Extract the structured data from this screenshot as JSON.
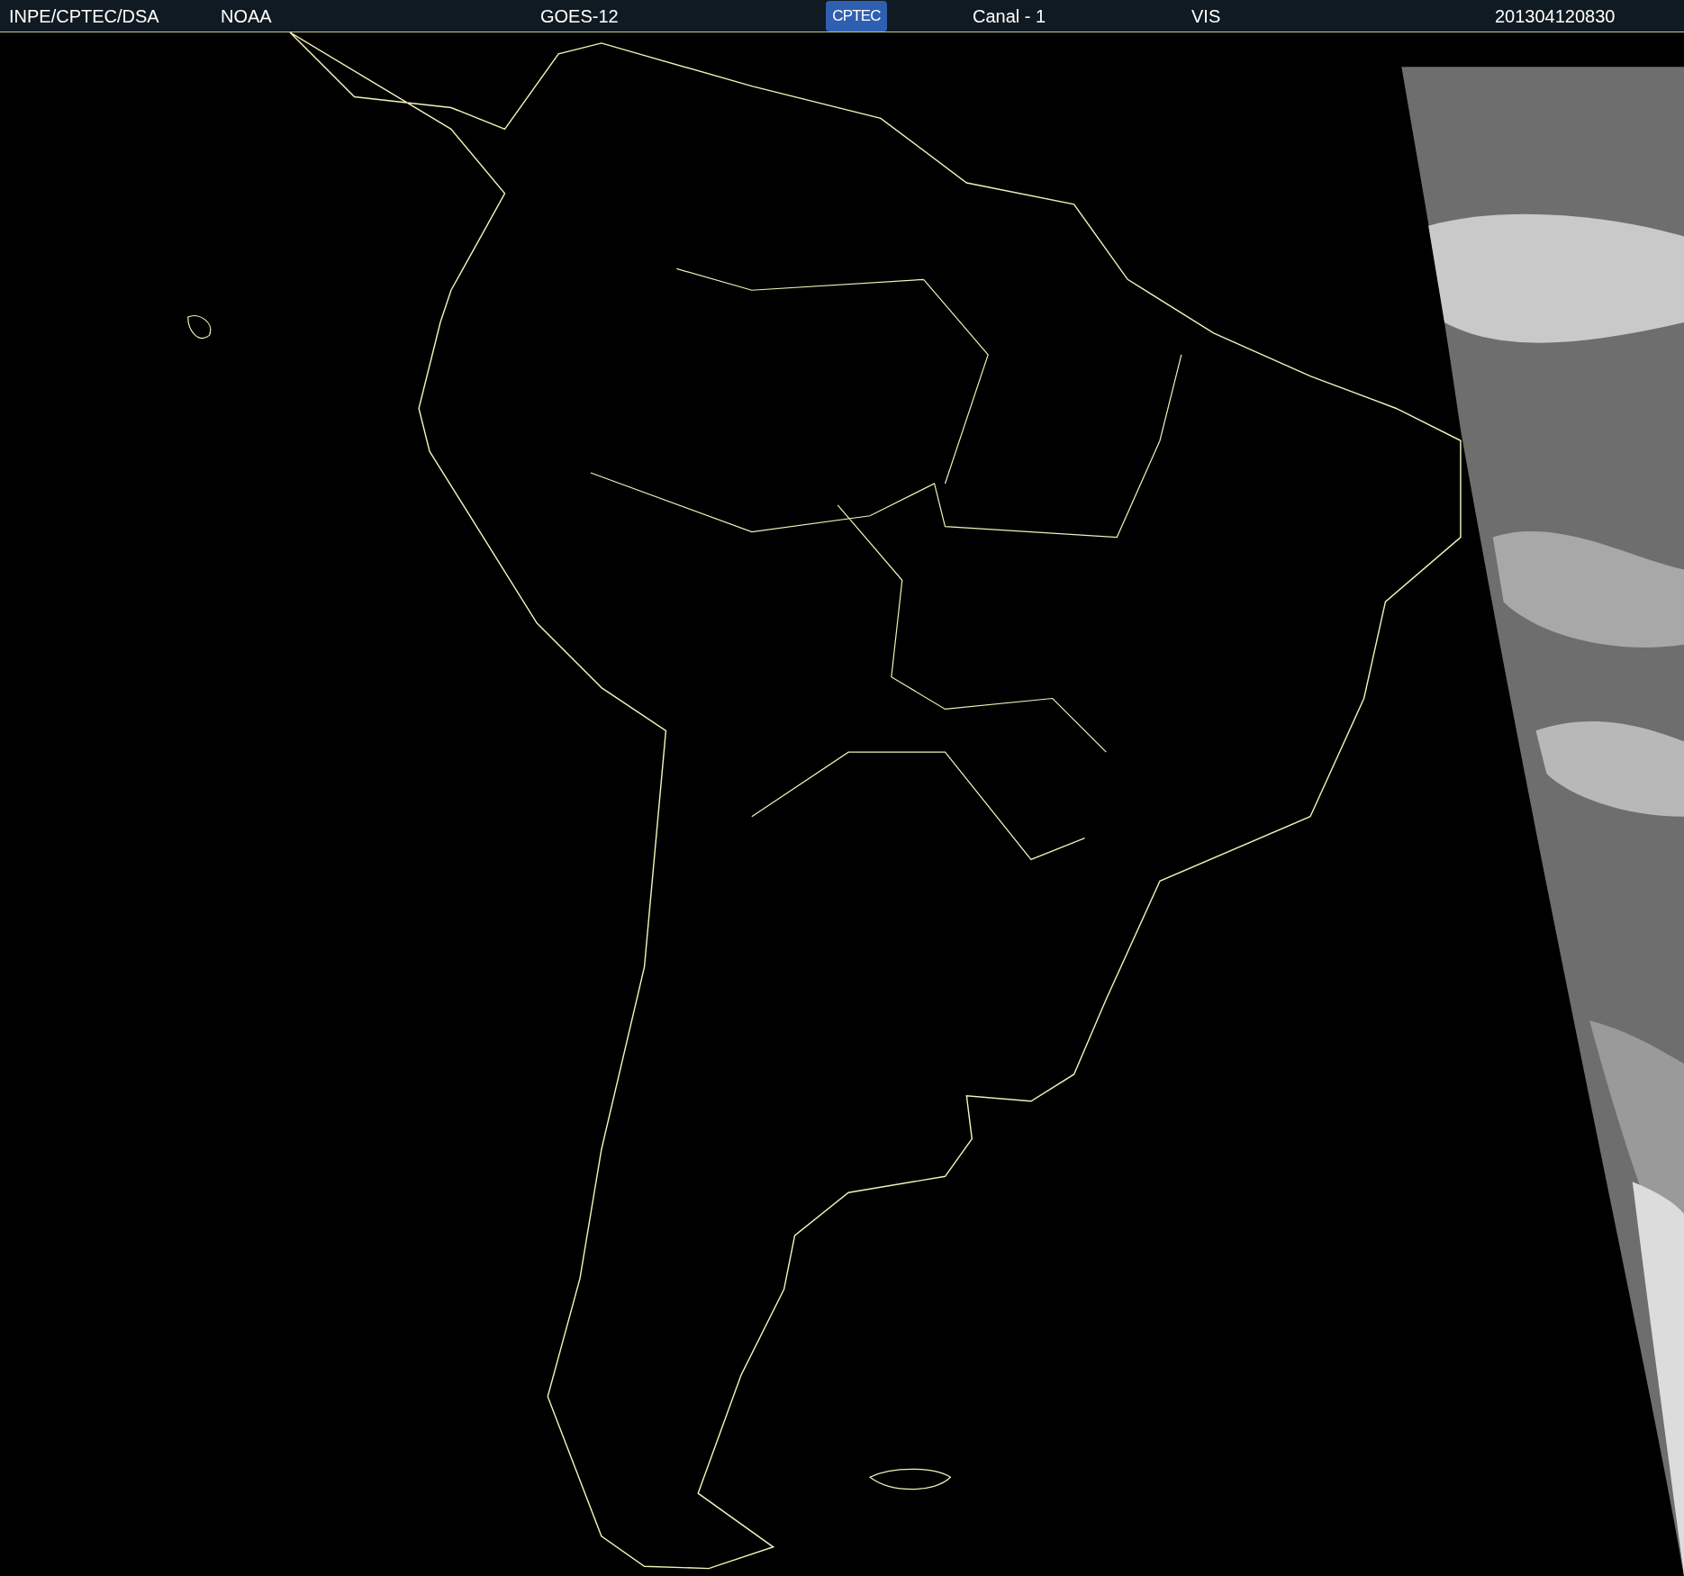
{
  "header": {
    "items": [
      {
        "kind": "text",
        "text": "INPE/CPTEC/DSA"
      },
      {
        "kind": "text",
        "text": "NOAA"
      },
      {
        "kind": "text",
        "text": "GOES-12"
      },
      {
        "kind": "logo",
        "text": "CPTEC"
      },
      {
        "kind": "text",
        "text": "Canal - 1"
      },
      {
        "kind": "text",
        "text": "VIS"
      },
      {
        "kind": "text",
        "text": "201304120830"
      }
    ]
  }
}
